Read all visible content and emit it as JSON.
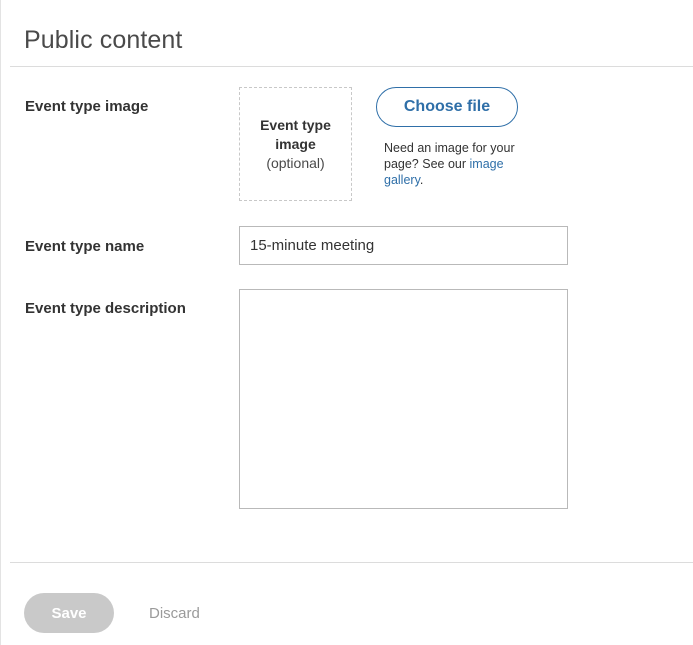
{
  "section": {
    "title": "Public content"
  },
  "image_field": {
    "label": "Event type image",
    "dropzone_title": "Event type image",
    "dropzone_hint": "(optional)",
    "choose_button": "Choose file",
    "help_text": "Need an image for your page? See our",
    "help_link": "image gallery",
    "help_end": "."
  },
  "name_field": {
    "label": "Event type name",
    "value": "15-minute meeting"
  },
  "description_field": {
    "label": "Event type description",
    "value": ""
  },
  "actions": {
    "save_label": "Save",
    "discard_label": "Discard"
  },
  "colors": {
    "accent": "#2f6fa8",
    "disabled": "#c9c9c9"
  }
}
